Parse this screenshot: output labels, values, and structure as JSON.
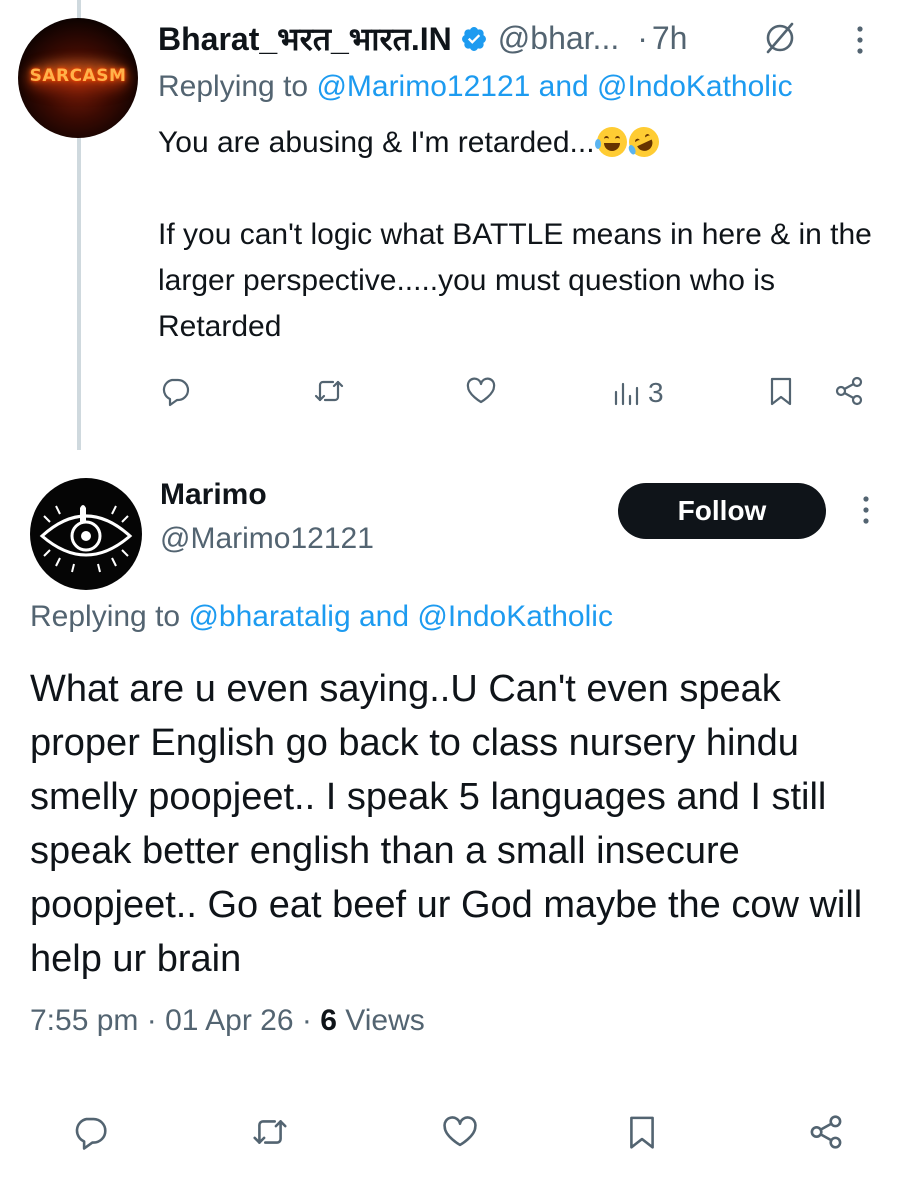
{
  "tweet1": {
    "author_name": "Bharat_भरत_भारत.IN",
    "verified": true,
    "handle": "@bhar...",
    "separator": "·",
    "time": "7h",
    "avatar_text": "SARCASM",
    "replying_prefix": "Replying to",
    "replying_mentions": "@Marimo12121 and @IndoKatholic",
    "body_line1": "You are abusing & I'm retarded...",
    "body_paragraph2": "If you can't logic what BATTLE means in here & in the larger perspective.....you must question who is Retarded",
    "emojis": [
      "face-with-tears-of-joy",
      "rolling-on-the-floor-laughing"
    ],
    "views": "3",
    "icons": [
      "verified-badge-icon",
      "grok-icon",
      "more-icon",
      "reply-icon",
      "retweet-icon",
      "like-icon",
      "views-icon",
      "bookmark-icon",
      "share-icon"
    ]
  },
  "tweet2": {
    "author_name": "Marimo",
    "handle": "@Marimo12121",
    "follow_label": "Follow",
    "replying_prefix": "Replying to",
    "replying_mentions": "@bharatalig and @IndoKatholic",
    "body": "What are u even saying..U Can't even speak proper English go back to class nursery hindu smelly poopjeet.. I speak 5 languages and I still speak better english than a small insecure poopjeet.. Go eat beef ur God maybe the cow will help ur brain",
    "time": "7:55 pm",
    "separator": "·",
    "date": "01 Apr 26",
    "views_count": "6",
    "views_label": "Views",
    "icons": [
      "more-icon",
      "reply-icon",
      "retweet-icon",
      "like-icon",
      "bookmark-icon",
      "share-icon"
    ]
  },
  "colors": {
    "text": "#0f1419",
    "secondary": "#536471",
    "link": "#1d9bf0",
    "thread_line": "#cfd9de",
    "follow_bg": "#0f1419"
  }
}
